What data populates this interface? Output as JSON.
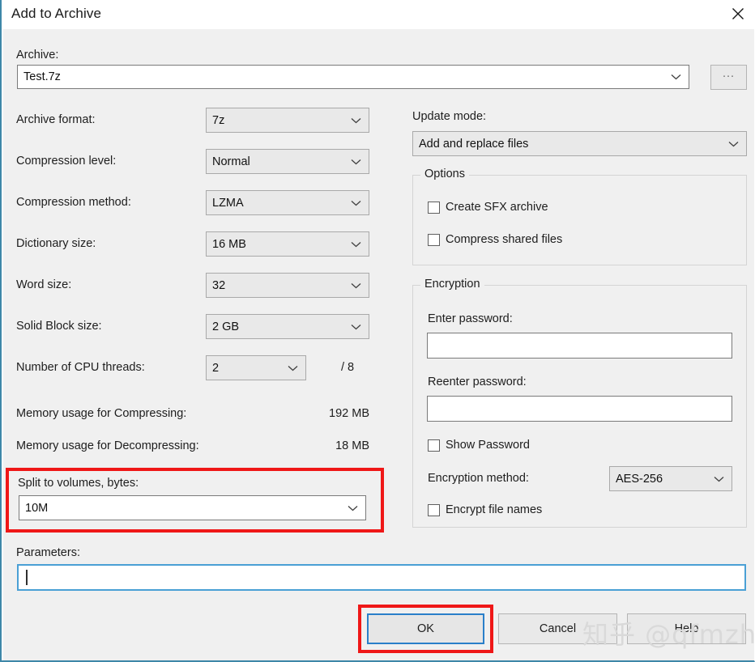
{
  "window": {
    "title": "Add to Archive",
    "close_icon": "close-icon",
    "accent_color": "#3e87a8",
    "background": "#f0f0f0",
    "highlight_color": "#ef1717",
    "focus_color": "#2a7fc9"
  },
  "archive": {
    "label": "Archive:",
    "value": "Test.7z",
    "browse_label": "...",
    "dropdown_icon": "chevron-down-icon"
  },
  "left": {
    "fields": [
      {
        "label": "Archive format:",
        "value": "7z"
      },
      {
        "label": "Compression level:",
        "value": "Normal"
      },
      {
        "label": "Compression method:",
        "value": "LZMA"
      },
      {
        "label": "Dictionary size:",
        "value": "16 MB"
      },
      {
        "label": "Word size:",
        "value": "32"
      },
      {
        "label": "Solid Block size:",
        "value": "2 GB"
      }
    ],
    "cpu": {
      "label": "Number of CPU threads:",
      "value": "2",
      "total": "/ 8"
    },
    "memory": [
      {
        "label": "Memory usage for Compressing:",
        "value": "192 MB"
      },
      {
        "label": "Memory usage for Decompressing:",
        "value": "18 MB"
      }
    ],
    "split": {
      "label": "Split to volumes, bytes:",
      "value": "10M"
    },
    "parameters": {
      "label": "Parameters:",
      "value": ""
    }
  },
  "right": {
    "update_mode": {
      "label": "Update mode:",
      "value": "Add and replace files"
    },
    "options": {
      "title": "Options",
      "items": [
        {
          "label": "Create SFX archive",
          "checked": false
        },
        {
          "label": "Compress shared files",
          "checked": false
        }
      ]
    },
    "encryption": {
      "title": "Encryption",
      "enter_password_label": "Enter password:",
      "enter_password_value": "",
      "reenter_password_label": "Reenter password:",
      "reenter_password_value": "",
      "show_password_label": "Show Password",
      "show_password_checked": false,
      "method_label": "Encryption method:",
      "method_value": "AES-256",
      "encrypt_names_label": "Encrypt file names",
      "encrypt_names_checked": false
    }
  },
  "buttons": {
    "ok": "OK",
    "cancel": "Cancel",
    "help": "Help"
  },
  "watermark": {
    "text": "知乎 @qfmzhu"
  }
}
